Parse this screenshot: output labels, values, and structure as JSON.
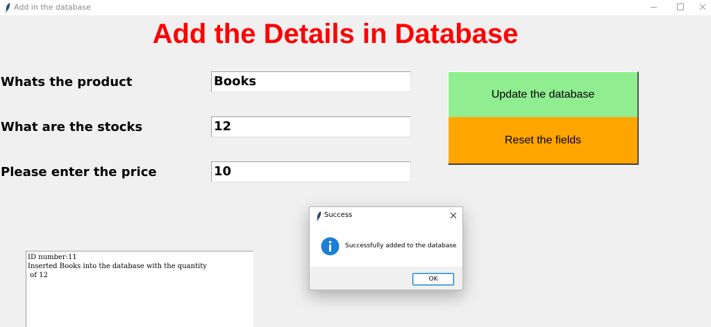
{
  "window": {
    "title": "Add in the database",
    "icon": "feather-icon",
    "controls": [
      "minimize-icon",
      "maximize-icon",
      "close-icon"
    ]
  },
  "heading": "Add the Details in Database",
  "form": {
    "product_label": "Whats the product",
    "product_value": "Books",
    "stocks_label": "What are the stocks",
    "stocks_value": "12",
    "price_label": "Please enter the price",
    "price_value": "10"
  },
  "buttons": {
    "update_label": "Update the database",
    "reset_label": "Reset the fields"
  },
  "log": {
    "lines": [
      "ID number:11",
      "",
      "Inserted Books into the database with the quantity",
      " of 12"
    ]
  },
  "dialog": {
    "title": "Success",
    "icon": "info-icon",
    "message": "Successfully added to the database",
    "ok_label": "OK"
  },
  "colors": {
    "heading": "#ff0000",
    "update_button": "#90ee90",
    "reset_button": "#ffa500",
    "info_icon": "#1a7fd6",
    "ok_border": "#0078d7"
  }
}
